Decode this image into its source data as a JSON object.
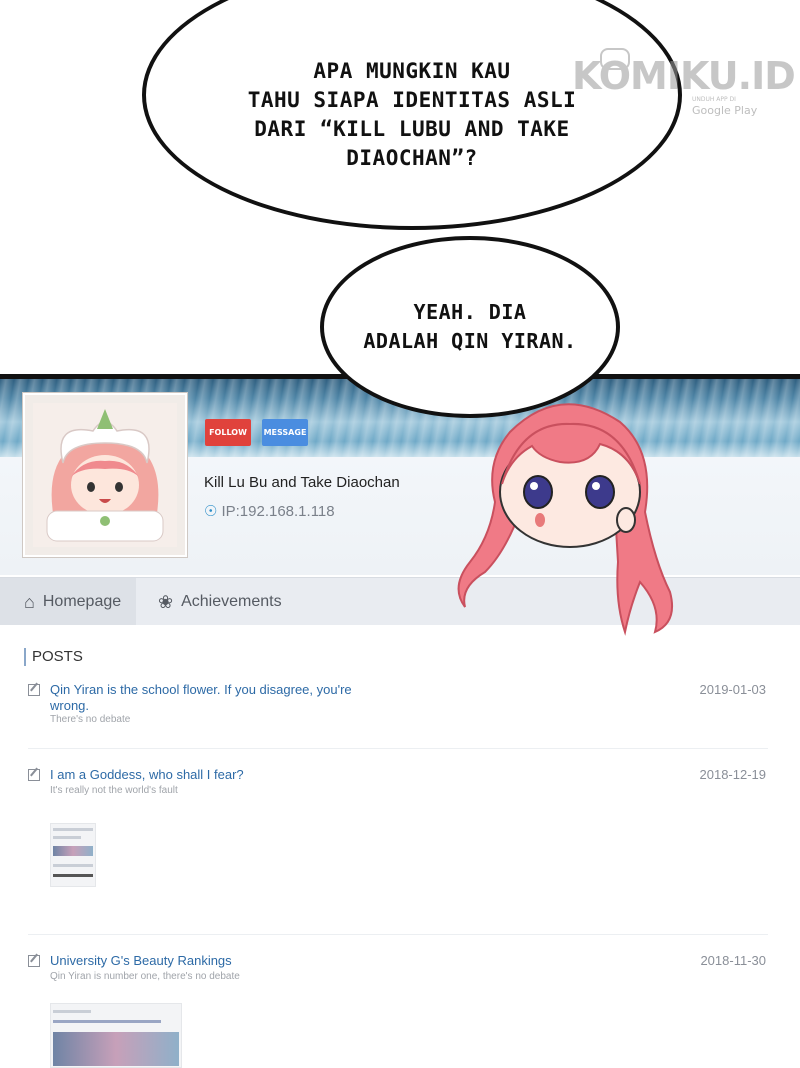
{
  "bubbles": {
    "top": "APA MUNGKIN KAU\nTAHU SIAPA IDENTITAS ASLI\nDARI “KILL LUBU AND TAKE\nDIAOCHAN”?",
    "middle": "YEAH. DIA\nADALAH QIN YIRAN."
  },
  "watermark": {
    "logo": "KOMIKU.ID",
    "sub": "UNDUH APP DI",
    "store": "Google Play"
  },
  "profile": {
    "follow_label": "FOLLOW",
    "message_label": "MESSAGE",
    "username": "Kill Lu Bu and Take Diaochan",
    "ip": "IP:192.168.1.118"
  },
  "tabs": [
    {
      "label": "Homepage",
      "icon": "home-icon"
    },
    {
      "label": "Achievements",
      "icon": "award-icon"
    }
  ],
  "posts_title": "POSTS",
  "posts": [
    {
      "title": "Qin Yiran is the school flower. If you disagree, you're wrong.",
      "subtitle": "There's no debate",
      "date": "2019-01-03"
    },
    {
      "title": "I am a Goddess, who shall I fear?",
      "subtitle": "It's really not the world's fault",
      "date": "2018-12-19"
    },
    {
      "title": "University G's Beauty Rankings",
      "subtitle": "Qin Yiran is number one, there's no debate",
      "date": "2018-11-30"
    }
  ],
  "colors": {
    "follow": "#e0423c",
    "message": "#4a8de0",
    "link": "#2d6aa6",
    "hair": "#f07a86"
  }
}
